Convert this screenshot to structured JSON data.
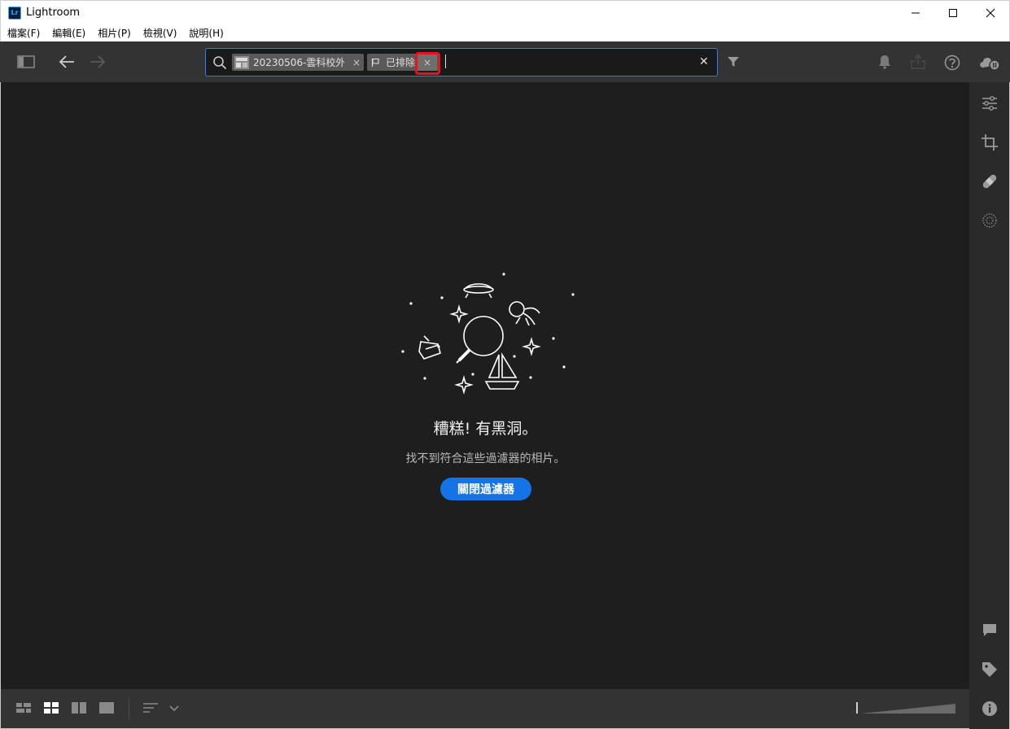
{
  "window": {
    "app_icon_text": "Lr",
    "title": "Lightroom"
  },
  "menu": {
    "items": [
      {
        "label": "檔案(F)"
      },
      {
        "label": "編輯(E)"
      },
      {
        "label": "相片(P)"
      },
      {
        "label": "檢視(V)"
      },
      {
        "label": "說明(H)"
      }
    ]
  },
  "toolbar": {
    "icons": [
      "sidebar-toggle-icon",
      "back-arrow-icon",
      "forward-arrow-icon",
      "filter-icon",
      "bell-icon",
      "share-icon",
      "help-icon",
      "cloud-sync-icon"
    ]
  },
  "search": {
    "album_chip_label": "20230506-雲科校外...",
    "flag_chip_label": "已排除",
    "remove_symbol": "×",
    "clear_symbol": "✕"
  },
  "empty_state": {
    "title": "糟糕! 有黑洞。",
    "message": "找不到符合這些過濾器的相片。",
    "button_label": "關閉過濾器"
  },
  "right_panel": {
    "icons": [
      "edit-sliders-icon",
      "crop-icon",
      "healing-icon",
      "masking-icon",
      "comment-icon",
      "tag-icon",
      "info-icon"
    ]
  },
  "bottom_bar": {
    "icons": [
      "square-grid-view-icon",
      "photo-grid-view-icon",
      "compare-view-icon",
      "detail-view-icon",
      "sort-icon",
      "chevron-down-icon"
    ]
  },
  "colors": {
    "accent": "#1473e6",
    "highlight_annotation": "#e8141c",
    "search_border": "#2d7ff9"
  }
}
